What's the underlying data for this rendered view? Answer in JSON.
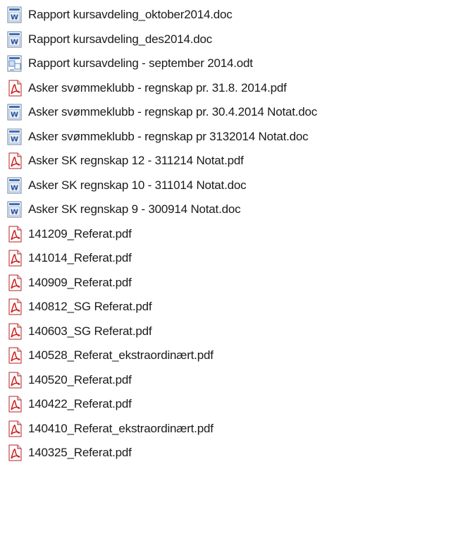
{
  "icons": {
    "word-doc-icon": "MS Word document",
    "odt-doc-icon": "OpenDocument text",
    "pdf-icon": "PDF document"
  },
  "files": [
    {
      "name": "Rapport kursavdeling_oktober2014.doc",
      "icon": "word-doc-icon"
    },
    {
      "name": "Rapport kursavdeling_des2014.doc",
      "icon": "word-doc-icon"
    },
    {
      "name": "Rapport kursavdeling - september 2014.odt",
      "icon": "odt-doc-icon"
    },
    {
      "name": "Asker svømmeklubb - regnskap pr. 31.8. 2014.pdf",
      "icon": "pdf-icon"
    },
    {
      "name": "Asker svømmeklubb - regnskap pr. 30.4.2014  Notat.doc",
      "icon": "word-doc-icon"
    },
    {
      "name": "Asker svømmeklubb - regnskap pr 3132014 Notat.doc",
      "icon": "word-doc-icon"
    },
    {
      "name": "Asker SK regnskap 12 - 311214 Notat.pdf",
      "icon": "pdf-icon"
    },
    {
      "name": "Asker SK regnskap 10 - 311014 Notat.doc",
      "icon": "word-doc-icon"
    },
    {
      "name": "Asker SK regnskap 9 - 300914 Notat.doc",
      "icon": "word-doc-icon"
    },
    {
      "name": "141209_Referat.pdf",
      "icon": "pdf-icon"
    },
    {
      "name": "141014_Referat.pdf",
      "icon": "pdf-icon"
    },
    {
      "name": "140909_Referat.pdf",
      "icon": "pdf-icon"
    },
    {
      "name": "140812_SG Referat.pdf",
      "icon": "pdf-icon"
    },
    {
      "name": "140603_SG Referat.pdf",
      "icon": "pdf-icon"
    },
    {
      "name": "140528_Referat_ekstraordinært.pdf",
      "icon": "pdf-icon"
    },
    {
      "name": "140520_Referat.pdf",
      "icon": "pdf-icon"
    },
    {
      "name": "140422_Referat.pdf",
      "icon": "pdf-icon"
    },
    {
      "name": "140410_Referat_ekstraordinært.pdf",
      "icon": "pdf-icon"
    },
    {
      "name": "140325_Referat.pdf",
      "icon": "pdf-icon"
    }
  ]
}
